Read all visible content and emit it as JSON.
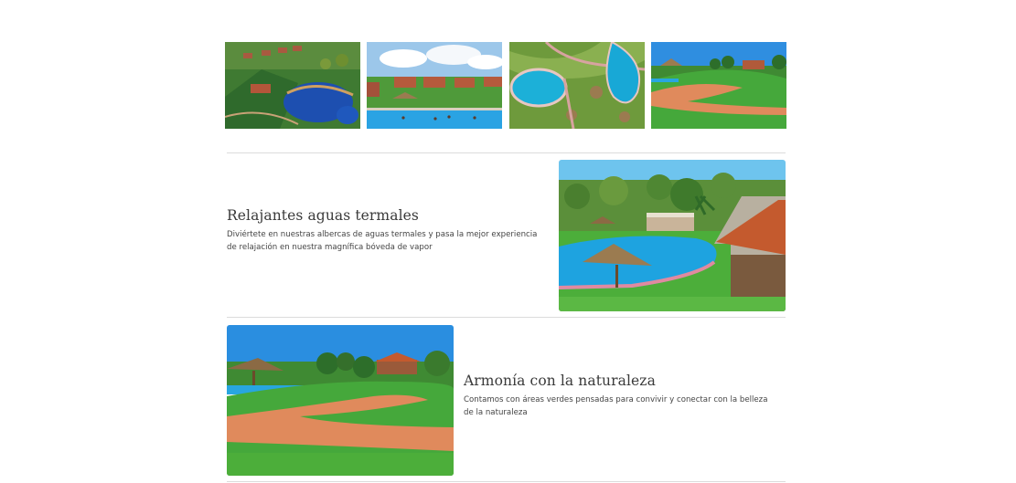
{
  "gallery": {
    "images": [
      {
        "name": "aerial-resort-pool-photo",
        "alt": ""
      },
      {
        "name": "pool-with-bungalows-photo",
        "alt": ""
      },
      {
        "name": "aerial-pools-photo",
        "alt": ""
      },
      {
        "name": "garden-path-photo",
        "alt": ""
      }
    ]
  },
  "features": [
    {
      "title": "Relajantes aguas termales",
      "description": "Diviértete en nuestras albercas de aguas termales y pasa la mejor experiencia de relajación en nuestra magnífica bóveda de vapor"
    },
    {
      "title": "Armonía con la naturaleza",
      "description": "Contamos con áreas verdes pensadas para convivir y conectar con la belleza de la naturaleza"
    }
  ],
  "colors": {
    "divider": "#dcdcdc",
    "sky": "#3a9be0",
    "pool": "#1ea3e0",
    "grass": "#4cae3a",
    "path": "#e0875a",
    "roof": "#c45a2e"
  }
}
